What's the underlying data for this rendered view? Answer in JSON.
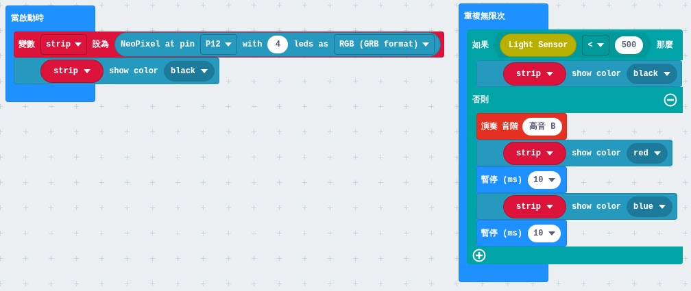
{
  "workspace": {
    "stacks": [
      {
        "hat": "當啟動時",
        "blocks": [
          {
            "kind": "variables",
            "items": [
              {
                "kind": "label",
                "text": "變數"
              },
              {
                "kind": "dropdown",
                "text": "strip"
              },
              {
                "kind": "label",
                "text": "設為"
              },
              {
                "kind": "reporter",
                "items": [
                  {
                    "kind": "label",
                    "text": "NeoPixel at pin"
                  },
                  {
                    "kind": "dropdown",
                    "text": "P12"
                  },
                  {
                    "kind": "label",
                    "text": "with"
                  },
                  {
                    "kind": "number",
                    "text": "4"
                  },
                  {
                    "kind": "label",
                    "text": "leds as"
                  },
                  {
                    "kind": "dropdown",
                    "text": "RGB (GRB format)"
                  }
                ]
              }
            ]
          },
          {
            "kind": "neopixel",
            "items": [
              {
                "kind": "var",
                "text": "strip"
              },
              {
                "kind": "label",
                "text": "show color"
              },
              {
                "kind": "color",
                "text": "black"
              }
            ]
          }
        ]
      },
      {
        "hat": "重複無限次",
        "blocks": [
          {
            "kind": "if_else",
            "if_label": "如果",
            "condition": [
              {
                "kind": "sensor",
                "text": "Light Sensor"
              },
              {
                "kind": "dropdown",
                "text": "<"
              },
              {
                "kind": "number",
                "text": "500"
              }
            ],
            "then_label": "那麼",
            "then": [
              {
                "kind": "neopixel",
                "items": [
                  {
                    "kind": "var",
                    "text": "strip"
                  },
                  {
                    "kind": "label",
                    "text": "show color"
                  },
                  {
                    "kind": "color",
                    "text": "black"
                  }
                ]
              }
            ],
            "else_label": "否則",
            "else": [
              {
                "kind": "music",
                "items": [
                  {
                    "kind": "label",
                    "text": "演奏"
                  },
                  {
                    "kind": "label",
                    "text": "音階"
                  },
                  {
                    "kind": "note",
                    "text": "高音 B"
                  }
                ]
              },
              {
                "kind": "neopixel",
                "items": [
                  {
                    "kind": "var",
                    "text": "strip"
                  },
                  {
                    "kind": "label",
                    "text": "show color"
                  },
                  {
                    "kind": "color",
                    "text": "red"
                  }
                ]
              },
              {
                "kind": "basic",
                "items": [
                  {
                    "kind": "label",
                    "text": "暫停 (ms)"
                  },
                  {
                    "kind": "number_dropdown",
                    "text": "10"
                  }
                ]
              },
              {
                "kind": "neopixel",
                "items": [
                  {
                    "kind": "var",
                    "text": "strip"
                  },
                  {
                    "kind": "label",
                    "text": "show color"
                  },
                  {
                    "kind": "color",
                    "text": "blue"
                  }
                ]
              },
              {
                "kind": "basic",
                "items": [
                  {
                    "kind": "label",
                    "text": "暫停 (ms)"
                  },
                  {
                    "kind": "number_dropdown",
                    "text": "10"
                  }
                ]
              }
            ]
          }
        ]
      }
    ]
  }
}
